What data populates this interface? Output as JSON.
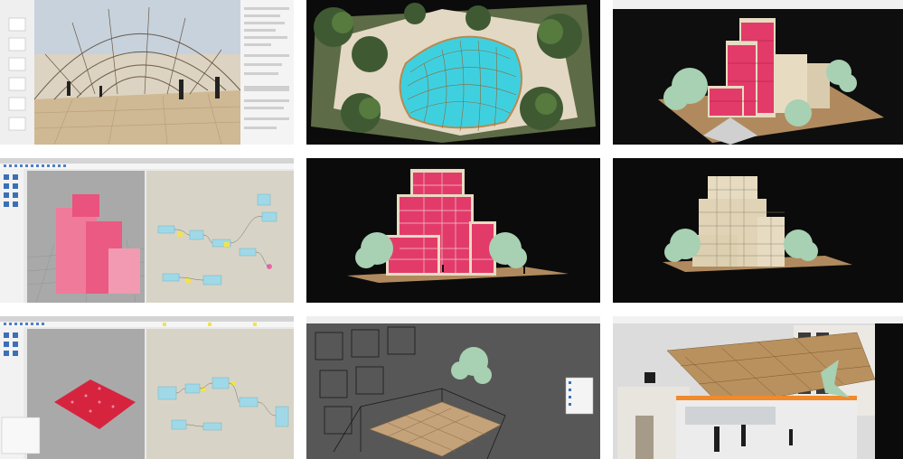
{
  "collage": {
    "rows": 3,
    "columns": 3
  },
  "colors": {
    "background": "#ffffff",
    "render_background": "#0b0b0b",
    "facade_pink": "#e23b6a",
    "facade_beige": "#e7dcc2",
    "tree_green": "#a8d0b2",
    "ground_wood": "#b08a5e",
    "viewport_gray": "#9a9a9a",
    "canvas_beige": "#d7d4c7",
    "node_cyan": "#9fd9e8",
    "node_yellow": "#f3e34a",
    "glass_cyan": "#3fd0e0"
  },
  "panels": [
    {
      "name": "gridshell-interior-modeling"
    },
    {
      "name": "gridshell-aerial-render"
    },
    {
      "name": "pink-tower-model-view"
    },
    {
      "name": "rhino-grasshopper-facade"
    },
    {
      "name": "pink-facade-render"
    },
    {
      "name": "beige-facade-render"
    },
    {
      "name": "rhino-grasshopper-pavilion"
    },
    {
      "name": "wireframe-canopy-view"
    },
    {
      "name": "canopy-interior-render"
    }
  ]
}
